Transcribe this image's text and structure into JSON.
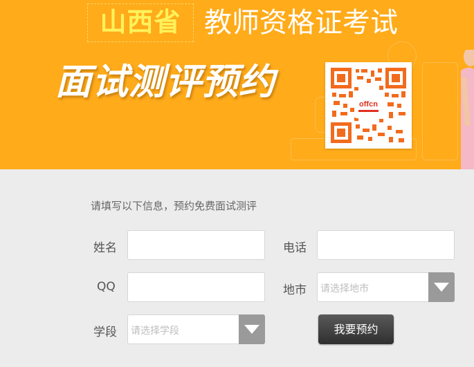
{
  "header": {
    "province": "山西省",
    "exam_name": "教师资格证考试",
    "title": "面试测评预约",
    "qr_code": {
      "description_icon": "qr-code-icon",
      "brand_text": "offcn"
    }
  },
  "form": {
    "intro": "请填写以下信息，预约免费面试测评",
    "fields": {
      "name_label": "姓名",
      "phone_label": "电话",
      "qq_label": "QQ",
      "city_label": "地市",
      "city_placeholder": "请选择地市",
      "stage_label": "学段",
      "stage_placeholder": "请选择学段"
    },
    "submit_label": "我要预约"
  },
  "colors": {
    "banner_bg": "#ffab1a",
    "province_text": "#fff25a",
    "page_bg": "#ececec",
    "button_bg": "#3a3a3a",
    "select_arrow_bg": "#9a9a9a"
  }
}
